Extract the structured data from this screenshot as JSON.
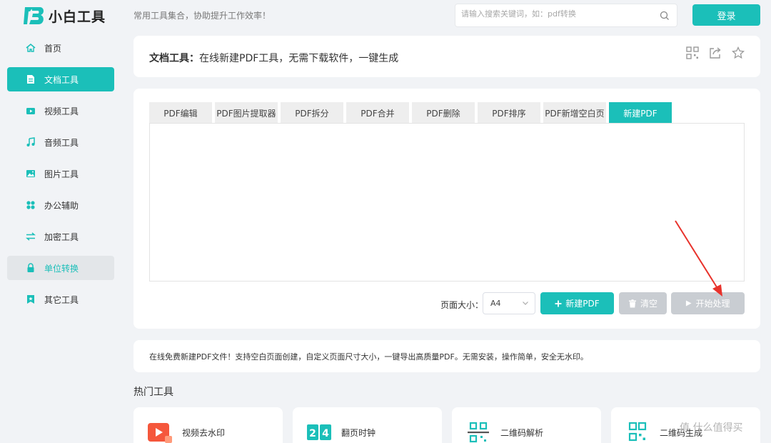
{
  "brand": {
    "name": "小白工具",
    "tagline": "常用工具集合，协助提升工作效率！"
  },
  "search": {
    "placeholder": "请输入搜索关键词，如：pdf转换"
  },
  "header": {
    "login_label": "登录"
  },
  "sidebar": {
    "items": [
      {
        "label": "首页",
        "icon": "home-icon"
      },
      {
        "label": "文档工具",
        "icon": "document-icon"
      },
      {
        "label": "视频工具",
        "icon": "video-icon"
      },
      {
        "label": "音频工具",
        "icon": "music-icon"
      },
      {
        "label": "图片工具",
        "icon": "image-icon"
      },
      {
        "label": "办公辅助",
        "icon": "grid-icon"
      },
      {
        "label": "加密工具",
        "icon": "swap-icon"
      },
      {
        "label": "单位转换",
        "icon": "lock-icon"
      },
      {
        "label": "其它工具",
        "icon": "bookmark-icon"
      }
    ]
  },
  "title_bar": {
    "prefix": "文档工具：",
    "text": "在线新建PDF工具，无需下载软件，一键生成"
  },
  "tabs": [
    "PDF编辑",
    "PDF图片提取器",
    "PDF拆分",
    "PDF合并",
    "PDF删除",
    "PDF排序",
    "PDF新增空白页",
    "新建PDF"
  ],
  "active_tab": "新建PDF",
  "controls": {
    "page_size_label": "页面大小：",
    "page_size_value": "A4",
    "new_pdf_label": "新建PDF",
    "clear_label": "清空",
    "start_label": "开始处理"
  },
  "description": "在线免费新建PDF文件！支持空白页面创建，自定义页面尺寸大小，一键导出高质量PDF。无需安装，操作简单，安全无水印。",
  "hot_tools": {
    "title": "热门工具",
    "items": [
      {
        "name": "视频去水印",
        "icon": "video-watermark-icon"
      },
      {
        "name": "翻页时钟",
        "icon": "flip-clock-icon"
      },
      {
        "name": "二维码解析",
        "icon": "qr-scan-icon"
      },
      {
        "name": "二维码生成",
        "icon": "qr-code-icon"
      }
    ]
  },
  "watermark": "值 什么值得买",
  "colors": {
    "accent": "#1bbfb9",
    "disabled": "#c9cdd2",
    "arrow": "#e8322b"
  }
}
